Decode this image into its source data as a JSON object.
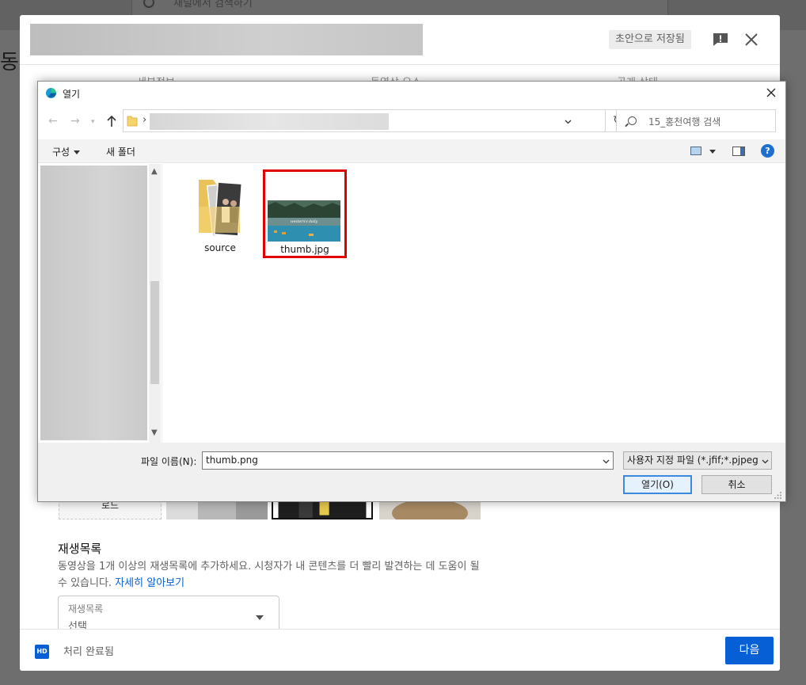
{
  "background_page": {
    "search_placeholder": "채널에서 검색하기",
    "heading_fragment": "동"
  },
  "upload_modal": {
    "draft_badge": "초안으로 저장됨",
    "steps": [
      "세부정보",
      "동영상 요소",
      "공개 상태"
    ],
    "thumbnail_upload_label": "로드",
    "playlist": {
      "title": "재생목록",
      "description": "동영상을 1개 이상의 재생목록에 추가하세요. 시청자가 내 콘텐츠를 더 빨리 발견하는 데 도움이 될 수 있습니다.",
      "learn_more": "자세히 알아보기",
      "select_label": "재생목록",
      "select_value": "선택"
    },
    "footer": {
      "hd_badge": "HD",
      "status": "처리 완료됨",
      "next_button": "다음"
    },
    "accent_color": "#065fd4"
  },
  "open_dialog": {
    "title": "열기",
    "search_placeholder": "15_홍천여행 검색",
    "toolbar": {
      "organize": "구성",
      "new_folder": "새 폴더"
    },
    "files": [
      {
        "name": "source",
        "type": "folder"
      },
      {
        "name": "thumb.jpg",
        "type": "image",
        "highlighted": true
      }
    ],
    "thumbnail_caption": "western's daily",
    "filename_label": "파일 이름(N):",
    "filename_value": "thumb.png",
    "file_type_filter": "사용자 지정 파일 (*.jfif;*.pjpeg",
    "open_button": "열기(O)",
    "cancel_button": "취소",
    "highlight_color": "#e00000"
  }
}
